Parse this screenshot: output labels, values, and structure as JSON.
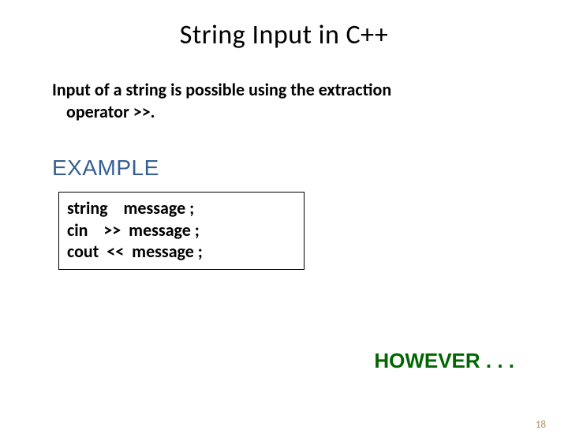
{
  "title": "String Input in C++",
  "body_line1": "Input of a string is possible using the extraction",
  "body_line2": "operator  >>.",
  "example_label": "EXAMPLE",
  "code": {
    "line1": "string    message ;",
    "line2": "cin    >>  message ;",
    "line3": "cout  <<  message ;"
  },
  "however": "HOWEVER . . .",
  "page_number": "18"
}
